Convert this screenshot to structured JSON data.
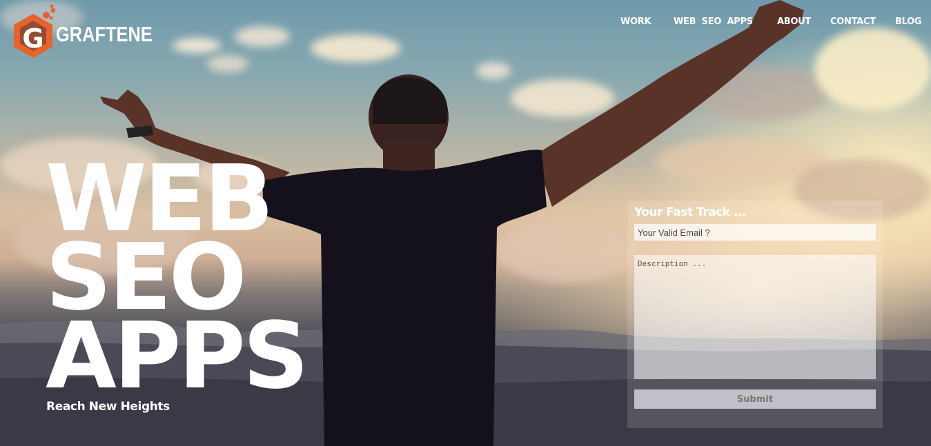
{
  "brand": {
    "name": "GRAFTENE",
    "logo_color": "#e8622c"
  },
  "nav": {
    "items": [
      {
        "label": "WORK"
      },
      {
        "label": "WEB  SEO  APPS"
      },
      {
        "label": "ABOUT"
      },
      {
        "label": "CONTACT"
      },
      {
        "label": "BLOG"
      }
    ]
  },
  "hero": {
    "lines": [
      "WEB",
      "SEO",
      "APPS"
    ],
    "tagline": "Reach New Heights"
  },
  "form": {
    "title": "Your Fast Track ...",
    "email_placeholder": "Your Valid Email ?",
    "description_placeholder": "Description ...",
    "submit_label": "Submit"
  },
  "background": {
    "description_icon": "man-arms-raised-sunset-image"
  }
}
